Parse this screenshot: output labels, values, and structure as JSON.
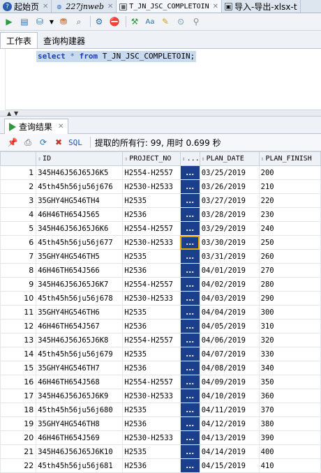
{
  "tabs": [
    {
      "label": "起始页",
      "icon": "help-icon",
      "style": "normal",
      "active": false
    },
    {
      "label": "227jnweb",
      "icon": "sql-connection-icon",
      "style": "mono",
      "active": false
    },
    {
      "label": "T_JN_JSC_COMPLETOIN",
      "icon": "table-icon",
      "style": "sql",
      "active": true
    },
    {
      "label": "导入-导出-xlsx-t",
      "icon": "import-icon",
      "style": "normal",
      "active": false
    }
  ],
  "subtabs": {
    "worksheet": "工作表",
    "query_builder": "查询构建器"
  },
  "editor": {
    "kw_select": "select",
    "star": "*",
    "kw_from": "from",
    "rest": "T_JN_JSC_COMPLETOIN;"
  },
  "result_tab": {
    "label": "查询结果"
  },
  "result_toolbar": {
    "sql_link": "SQL",
    "status": "提取的所有行: 99, 用时 0.699 秒"
  },
  "columns": [
    "ID",
    "PROJECT_NO",
    "...",
    "PLAN_DATE",
    "PLAN_FINISH"
  ],
  "rows": [
    [
      "1",
      "345H46J56J65J6K5",
      "H2554-H2557",
      "...",
      "03/25/2019",
      "200"
    ],
    [
      "2",
      "45th45h56ju56j676",
      "H2530-H2533",
      "...",
      "03/26/2019",
      "210"
    ],
    [
      "3",
      "35GHY4HG546TH4",
      "H2535",
      "...",
      "03/27/2019",
      "220"
    ],
    [
      "4",
      "46H46TH654J565",
      "H2536",
      "...",
      "03/28/2019",
      "230"
    ],
    [
      "5",
      "345H46J56J65J6K6",
      "H2554-H2557",
      "...",
      "03/29/2019",
      "240"
    ],
    [
      "6",
      "45th45h56ju56j677",
      "H2530-H2533",
      "...",
      "03/30/2019",
      "250"
    ],
    [
      "7",
      "35GHY4HG546TH5",
      "H2535",
      "...",
      "03/31/2019",
      "260"
    ],
    [
      "8",
      "46H46TH654J566",
      "H2536",
      "...",
      "04/01/2019",
      "270"
    ],
    [
      "9",
      "345H46J56J65J6K7",
      "H2554-H2557",
      "...",
      "04/02/2019",
      "280"
    ],
    [
      "10",
      "45th45h56ju56j678",
      "H2530-H2533",
      "...",
      "04/03/2019",
      "290"
    ],
    [
      "11",
      "35GHY4HG546TH6",
      "H2535",
      "...",
      "04/04/2019",
      "300"
    ],
    [
      "12",
      "46H46TH654J567",
      "H2536",
      "...",
      "04/05/2019",
      "310"
    ],
    [
      "13",
      "345H46J56J65J6K8",
      "H2554-H2557",
      "...",
      "04/06/2019",
      "320"
    ],
    [
      "14",
      "45th45h56ju56j679",
      "H2535",
      "...",
      "04/07/2019",
      "330"
    ],
    [
      "15",
      "35GHY4HG546TH7",
      "H2536",
      "...",
      "04/08/2019",
      "340"
    ],
    [
      "16",
      "46H46TH654J568",
      "H2554-H2557",
      "...",
      "04/09/2019",
      "350"
    ],
    [
      "17",
      "345H46J56J65J6K9",
      "H2530-H2533",
      "...",
      "04/10/2019",
      "360"
    ],
    [
      "18",
      "45th45h56ju56j680",
      "H2535",
      "...",
      "04/11/2019",
      "370"
    ],
    [
      "19",
      "35GHY4HG546TH8",
      "H2536",
      "...",
      "04/12/2019",
      "380"
    ],
    [
      "20",
      "46H46TH654J569",
      "H2530-H2533",
      "...",
      "04/13/2019",
      "390"
    ],
    [
      "21",
      "345H46J56J65J6K10",
      "H2535",
      "...",
      "04/14/2019",
      "400"
    ],
    [
      "22",
      "45th45h56ju56j681",
      "H2536",
      "...",
      "04/15/2019",
      "410"
    ]
  ],
  "selected_dots_row": 6
}
